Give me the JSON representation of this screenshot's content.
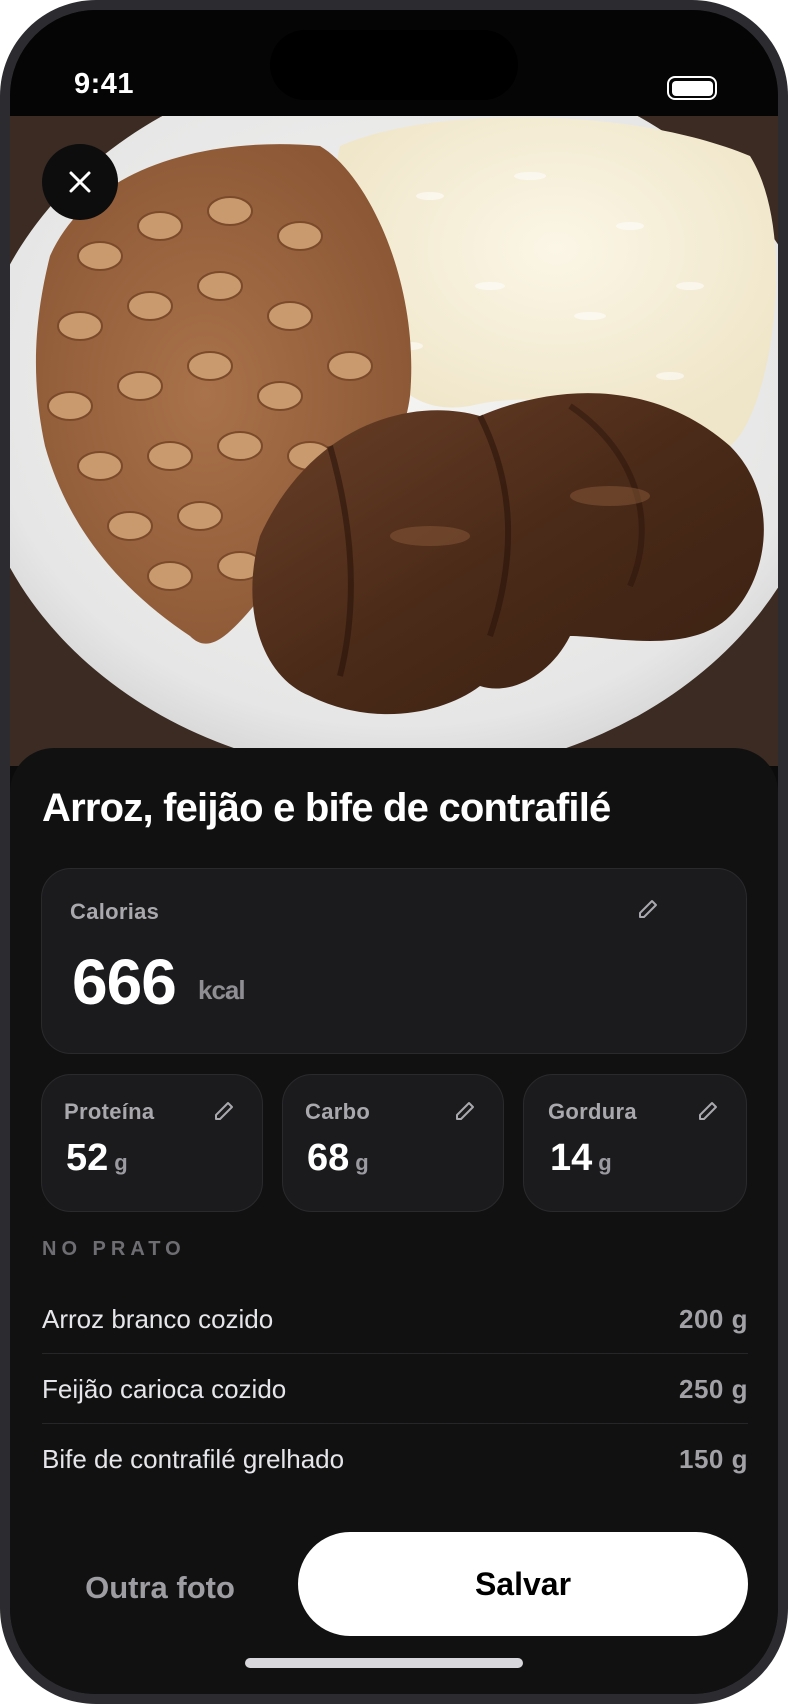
{
  "status_bar": {
    "time": "9:41",
    "battery_level": 1.0
  },
  "photo": {
    "description_icon": "food-photo"
  },
  "meal": {
    "title": "Arroz, feijão e bife de contrafilé"
  },
  "calories": {
    "label": "Calorias",
    "value": "666",
    "unit": "kcal"
  },
  "macros": [
    {
      "label": "Proteína",
      "value": "52",
      "unit": "g"
    },
    {
      "label": "Carbo",
      "value": "68",
      "unit": "g"
    },
    {
      "label": "Gordura",
      "value": "14",
      "unit": "g"
    }
  ],
  "plate": {
    "section_label": "NO PRATO",
    "items": [
      {
        "name": "Arroz branco cozido",
        "quantity": "200 g"
      },
      {
        "name": "Feijão carioca cozido",
        "quantity": "250 g"
      },
      {
        "name": "Bife de contrafilé grelhado",
        "quantity": "150 g"
      }
    ]
  },
  "actions": {
    "secondary_label": "Outra foto",
    "primary_label": "Salvar"
  },
  "colors": {
    "background": "#111112",
    "card": "#1b1b1d",
    "primary_button": "#ffffff"
  }
}
